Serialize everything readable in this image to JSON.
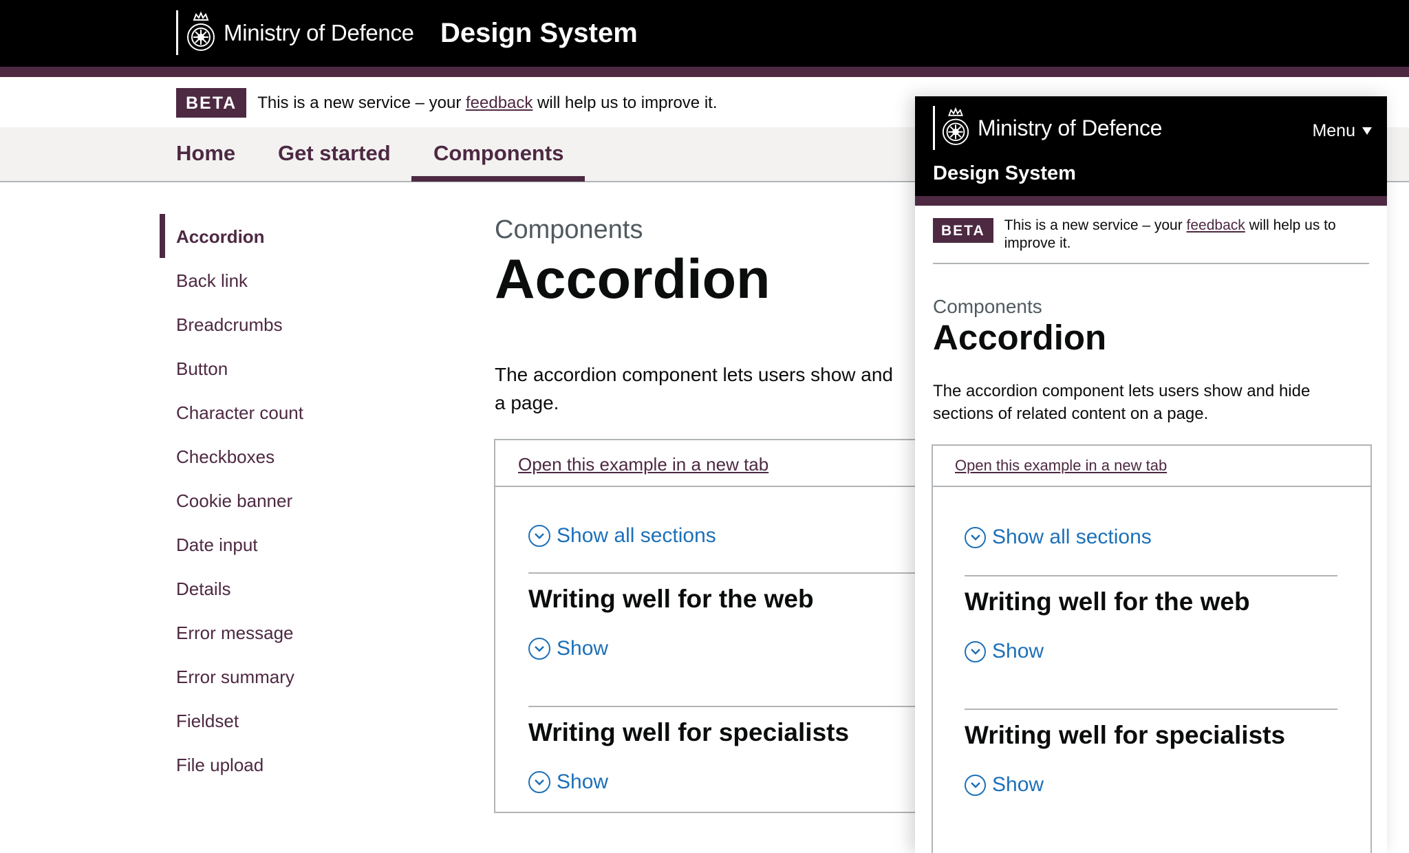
{
  "header": {
    "org_name": "Ministry of Defence",
    "service_title": "Design System",
    "crest_icon": "royal-crest-icon"
  },
  "phase_banner": {
    "tag": "BETA",
    "text_before": "This is a new service – your ",
    "link_text": "feedback",
    "text_after": " will help us to improve it."
  },
  "nav": {
    "items": [
      "Home",
      "Get started",
      "Components"
    ],
    "active": "Components"
  },
  "sidebar": {
    "items": [
      "Accordion",
      "Back link",
      "Breadcrumbs",
      "Button",
      "Character count",
      "Checkboxes",
      "Cookie banner",
      "Date input",
      "Details",
      "Error message",
      "Error summary",
      "Fieldset",
      "File upload"
    ],
    "active": "Accordion"
  },
  "main": {
    "caption": "Components",
    "title": "Accordion",
    "lede_desktop_line1": "The accordion component lets users show and",
    "lede_desktop_line2": "a page.",
    "lede_full": "The accordion component lets users show and hide sections of related content on a page.",
    "example_link": "Open this example in a new tab",
    "accordion": {
      "show_all": "Show all sections",
      "sections": [
        {
          "heading": "Writing well for the web",
          "toggle": "Show"
        },
        {
          "heading": "Writing well for specialists",
          "toggle": "Show"
        }
      ]
    }
  },
  "mobile": {
    "menu_label": "Menu"
  },
  "colors": {
    "brand": "#4d2942",
    "link_blue": "#1d70b8",
    "header_bg": "#000000",
    "nav_bg": "#f3f2f1"
  }
}
